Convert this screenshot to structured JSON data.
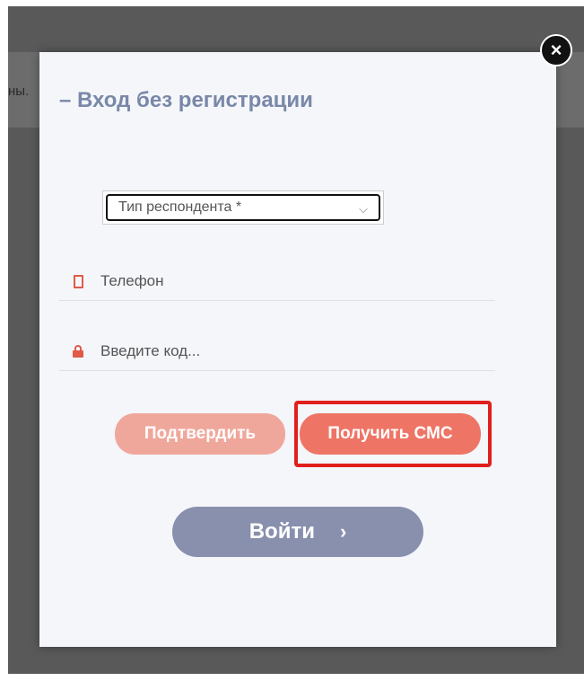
{
  "background": {
    "partial_text": "ны."
  },
  "modal": {
    "title": "– Вход без регистрации",
    "close_label": "×",
    "respondent_select": {
      "value": "Тип респондента *",
      "chevron": "⌵"
    },
    "phone_field": {
      "placeholder": "Телефон",
      "icon": "phone-icon"
    },
    "code_field": {
      "placeholder": "Введите код...",
      "icon": "lock-icon"
    },
    "confirm_button": "Подтвердить",
    "get_sms_button": "Получить СМС",
    "login_button": "Войти",
    "login_arrow": "›"
  },
  "colors": {
    "accent": "#ee7566",
    "accent_light": "#f0a79b",
    "login": "#8890ad",
    "title": "#7a88a8",
    "highlight": "#e0201c"
  }
}
